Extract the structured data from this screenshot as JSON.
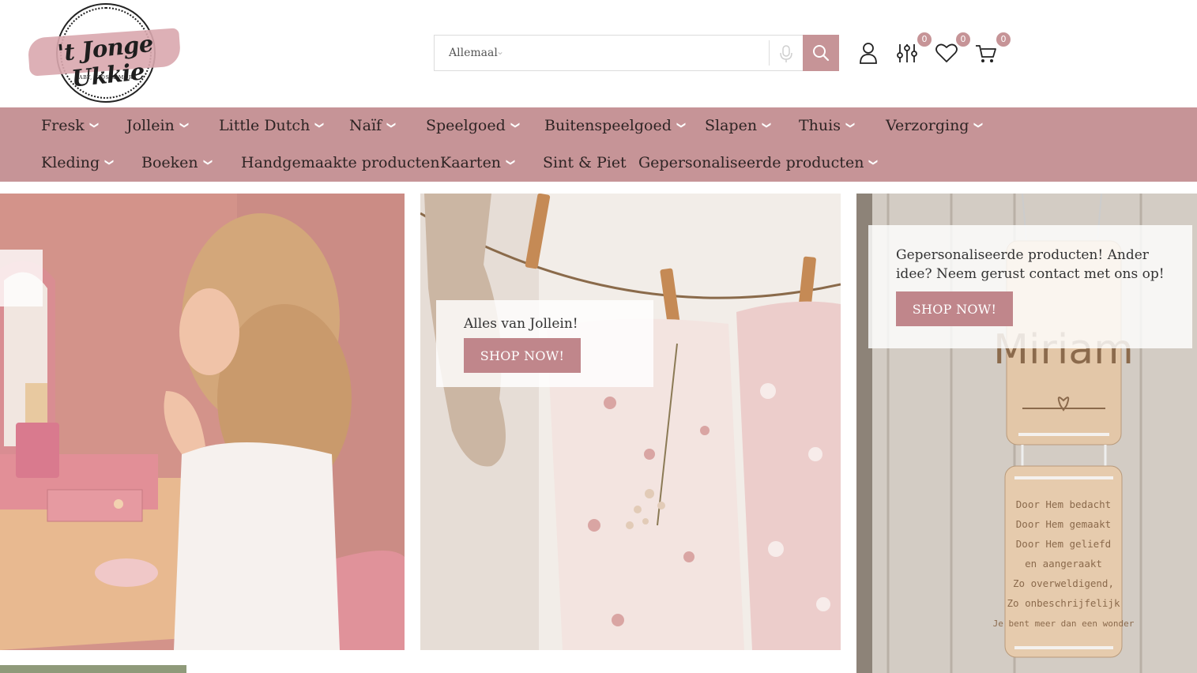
{
  "logo": {
    "name": "'t Jonge Ukkie",
    "tagline": "BABY, KIDS & MORE"
  },
  "search": {
    "category": "Allemaal",
    "placeholder": ""
  },
  "header_icons": {
    "compare_count": "0",
    "wishlist_count": "0",
    "cart_count": "0"
  },
  "nav": {
    "row1": [
      {
        "label": "Fresk",
        "dropdown": true
      },
      {
        "label": "Jollein",
        "dropdown": true
      },
      {
        "label": "Little Dutch",
        "dropdown": true
      },
      {
        "label": "Naïf",
        "dropdown": true
      },
      {
        "label": "Speelgoed",
        "dropdown": true
      },
      {
        "label": "Buitenspeelgoed",
        "dropdown": true
      },
      {
        "label": "Slapen",
        "dropdown": true
      },
      {
        "label": "Thuis",
        "dropdown": true
      },
      {
        "label": "Verzorging",
        "dropdown": true
      }
    ],
    "row2": [
      {
        "label": "Kleding",
        "dropdown": true
      },
      {
        "label": "Boeken",
        "dropdown": true
      },
      {
        "label": "Handgemaakte producten",
        "dropdown": false
      },
      {
        "label": "Kaarten",
        "dropdown": true
      },
      {
        "label": "Sint & Piet",
        "dropdown": false
      },
      {
        "label": "Gepersonaliseerde producten",
        "dropdown": true
      }
    ]
  },
  "banners": {
    "jollein": {
      "text": "Alles van Jollein!",
      "button": "SHOP NOW!"
    },
    "personalized": {
      "text": "Gepersonaliseerde producten! Ander idee? Neem gerust contact met ons op!",
      "button": "SHOP NOW!",
      "sign_top": "Miriam",
      "sign_bottom": [
        "Door Hem bedacht",
        "Door Hem gemaakt",
        "Door Hem geliefd",
        "en aangeraakt",
        "Zo overweldigend,",
        "Zo onbeschrijfelijk",
        "Je bent meer dan een wonder"
      ]
    }
  },
  "colors": {
    "accent": "#c69497",
    "button": "#c0868b"
  }
}
